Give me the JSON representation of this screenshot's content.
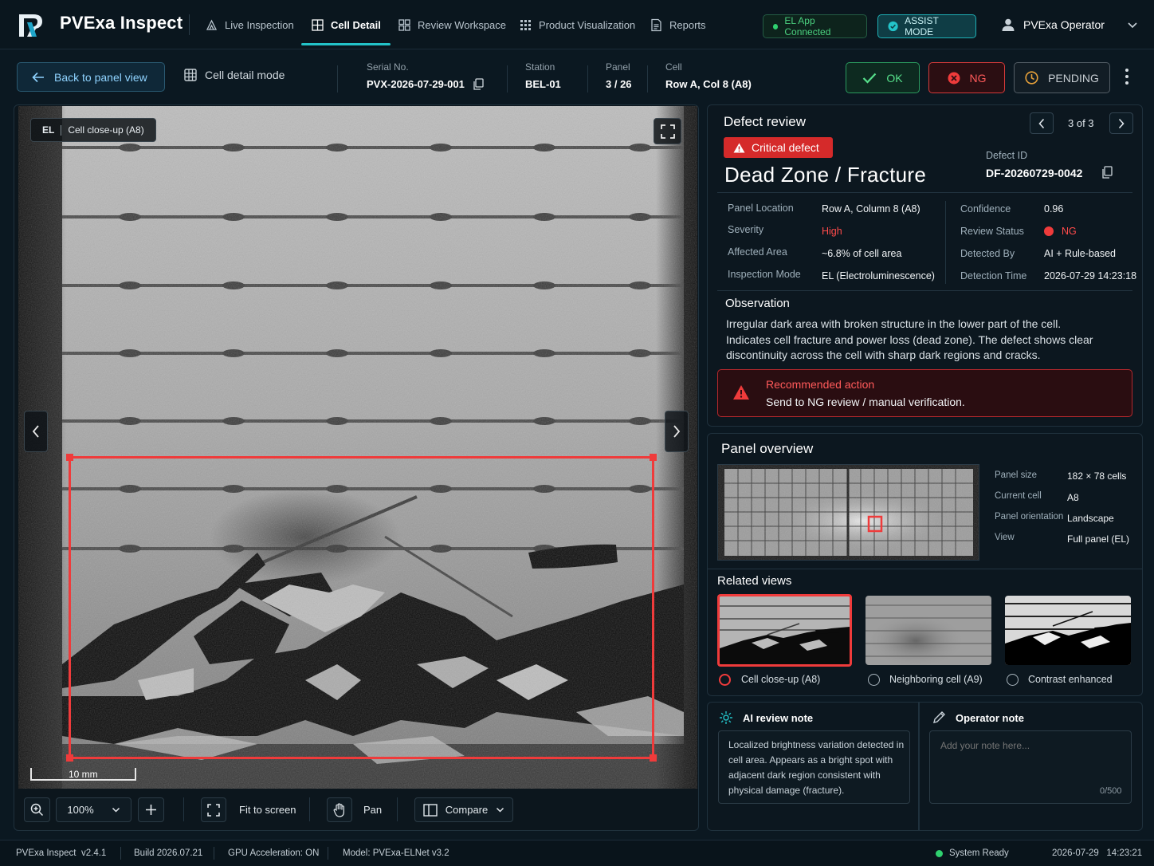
{
  "app": {
    "name": "PVExa Inspect"
  },
  "nav": {
    "items": [
      {
        "label": "Live Inspection",
        "icon": "camera-icon"
      },
      {
        "label": "Cell Detail",
        "icon": "grid-detail-icon",
        "active": true
      },
      {
        "label": "Review Workspace",
        "icon": "grid-icon"
      },
      {
        "label": "Product Visualization",
        "icon": "dots-grid-icon"
      },
      {
        "label": "Reports",
        "icon": "report-icon"
      }
    ]
  },
  "header": {
    "el_status": "EL App Connected",
    "assist_mode": "ASSIST MODE",
    "user": "PVExa Operator"
  },
  "subbar": {
    "back": "Back to panel view",
    "mode": "Cell detail mode",
    "serial_label": "Serial No.",
    "serial_value": "PVX-2026-07-29-001",
    "station_label": "Station",
    "station_value": "BEL-01",
    "panel_label": "Panel",
    "panel_value": "3 / 26",
    "cell_label": "Cell",
    "cell_value": "Row A, Col 8 (A8)",
    "ok": "OK",
    "ng": "NG",
    "pending": "PENDING"
  },
  "viewer": {
    "badge_mode": "EL",
    "badge_label": "Cell close-up (A8)",
    "scale": "10 mm",
    "zoom": "100%",
    "fit": "Fit to screen",
    "pan": "Pan",
    "compare": "Compare"
  },
  "defect": {
    "section_title": "Defect review",
    "pager": "3 of 3",
    "severity_badge": "Critical defect",
    "title": "Dead Zone / Fracture",
    "id_label": "Defect ID",
    "id_value": "DF-20260729-0042",
    "fields_left": [
      {
        "k": "Panel Location",
        "v": "Row A, Column 8 (A8)"
      },
      {
        "k": "Severity",
        "v": "High"
      },
      {
        "k": "Affected Area",
        "v": "~6.8% of cell area"
      },
      {
        "k": "Inspection Mode",
        "v": "EL (Electroluminescence)"
      }
    ],
    "fields_right": [
      {
        "k": "Confidence",
        "v": "0.96"
      },
      {
        "k": "Review Status",
        "v": "NG"
      },
      {
        "k": "Detected By",
        "v": "AI + Rule-based"
      },
      {
        "k": "Detection Time",
        "v": "2026-07-29 14:23:18"
      }
    ],
    "observation_title": "Observation",
    "observation_text": "Irregular dark area with broken structure in the lower part of the cell. Indicates cell fracture and power loss (dead zone). The defect shows clear discontinuity across the cell with sharp dark regions and cracks.",
    "rec_title": "Recommended action",
    "rec_text": "Send to NG review / manual verification."
  },
  "overview": {
    "title": "Panel overview",
    "fields": [
      {
        "k": "Panel size",
        "v": "182 × 78 cells"
      },
      {
        "k": "Current cell",
        "v": "A8"
      },
      {
        "k": "Panel orientation",
        "v": "Landscape"
      },
      {
        "k": "View",
        "v": "Full panel (EL)"
      }
    ],
    "related_title": "Related views",
    "related": [
      {
        "label": "Cell close-up (A8)",
        "selected": true
      },
      {
        "label": "Neighboring cell (A9)",
        "selected": false
      },
      {
        "label": "Contrast enhanced",
        "selected": false
      }
    ]
  },
  "notes": {
    "ai_title": "AI review note",
    "ai_text": "Localized brightness variation detected in cell area. Appears as a bright spot with adjacent dark region consistent with physical damage (fracture).",
    "op_title": "Operator note",
    "op_placeholder": "Add your note here...",
    "op_count": "0/500"
  },
  "status": {
    "app": "PVExa Inspect",
    "version": "v2.4.1",
    "build": "Build 2026.07.21",
    "gpu": "GPU Acceleration: ON",
    "model": "Model: PVExa-ELNet v3.2",
    "system": "System Ready",
    "datetime": "2026-07-29   14:23:21"
  },
  "colors": {
    "accent": "#23c3c9",
    "ok": "#56e08b",
    "ng": "#ef3b3b",
    "pending": "#e8a23a"
  }
}
